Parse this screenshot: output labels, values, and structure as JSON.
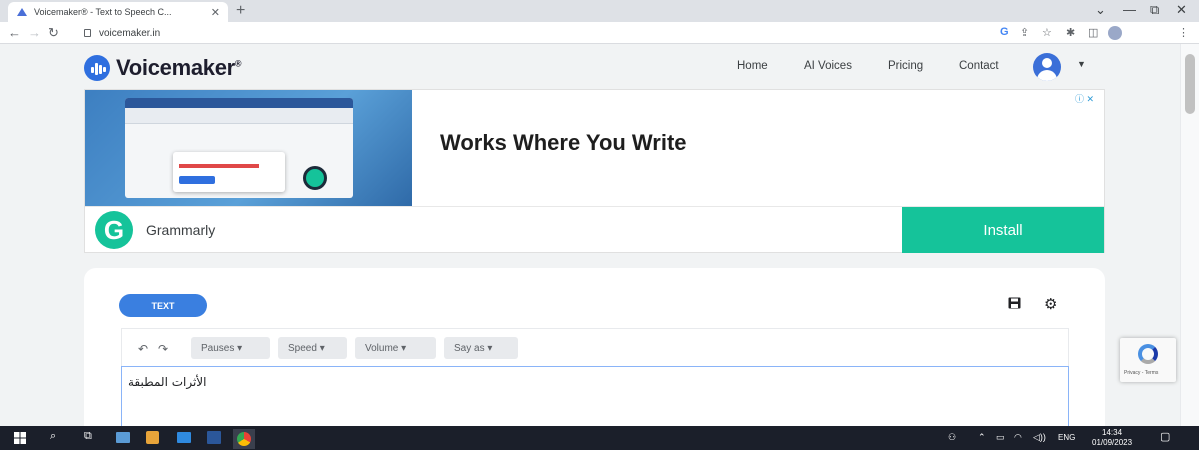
{
  "browser": {
    "tab_title": "Voicemaker® - Text to Speech C...",
    "tab_close": "✕",
    "new_tab": "+",
    "url": "voicemaker.in",
    "win_minimize": "—",
    "win_restore": "⧉",
    "win_close": "✕",
    "tab_search": "⌄"
  },
  "site": {
    "logo_text": "Voicemaker",
    "logo_mark": "®",
    "nav": {
      "home": "Home",
      "ai_voices": "AI Voices",
      "pricing": "Pricing",
      "contact": "Contact"
    }
  },
  "ad": {
    "headline": "Works Where You Write",
    "brand": "Grammarly",
    "cta": "Install",
    "g_letter": "G"
  },
  "editor": {
    "mode_button": "TEXT",
    "undo": "↶",
    "redo": "↷",
    "dropdowns": {
      "pauses": "Pauses ▾",
      "speed": "Speed ▾",
      "volume": "Volume ▾",
      "say_as": "Say as ▾"
    },
    "content": "الأثرات المطبقة"
  },
  "recaptcha": {
    "label": "Privacy - Terms"
  },
  "taskbar": {
    "language": "ENG",
    "time": "14:34",
    "date": "01/09/2023"
  },
  "colors": {
    "accent_blue": "#3a7fe0",
    "grammarly_green": "#15c39a"
  }
}
